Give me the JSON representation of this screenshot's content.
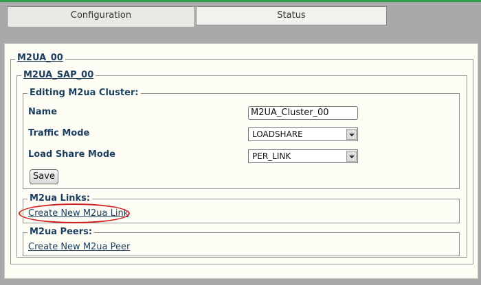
{
  "tabs": {
    "configuration": "Configuration",
    "status": "Status"
  },
  "m2ua": {
    "title": "M2UA_00",
    "sap": {
      "title": "M2UA_SAP_00",
      "cluster": {
        "legend": "Editing M2ua Cluster:",
        "name_label": "Name",
        "name_value": "M2UA_Cluster_00",
        "traffic_mode_label": "Traffic Mode",
        "traffic_mode_value": "LOADSHARE",
        "load_share_mode_label": "Load Share Mode",
        "load_share_mode_value": "PER_LINK",
        "save_label": "Save"
      },
      "links": {
        "legend": "M2ua Links:",
        "create_link": "Create New M2ua Link"
      },
      "peers": {
        "legend": "M2ua Peers:",
        "create_link": "Create New M2ua Peer"
      }
    }
  },
  "colors": {
    "accent_line": "#2e9e4a",
    "highlight_ellipse": "#d11f1f",
    "label_text": "#1c3f5e"
  }
}
